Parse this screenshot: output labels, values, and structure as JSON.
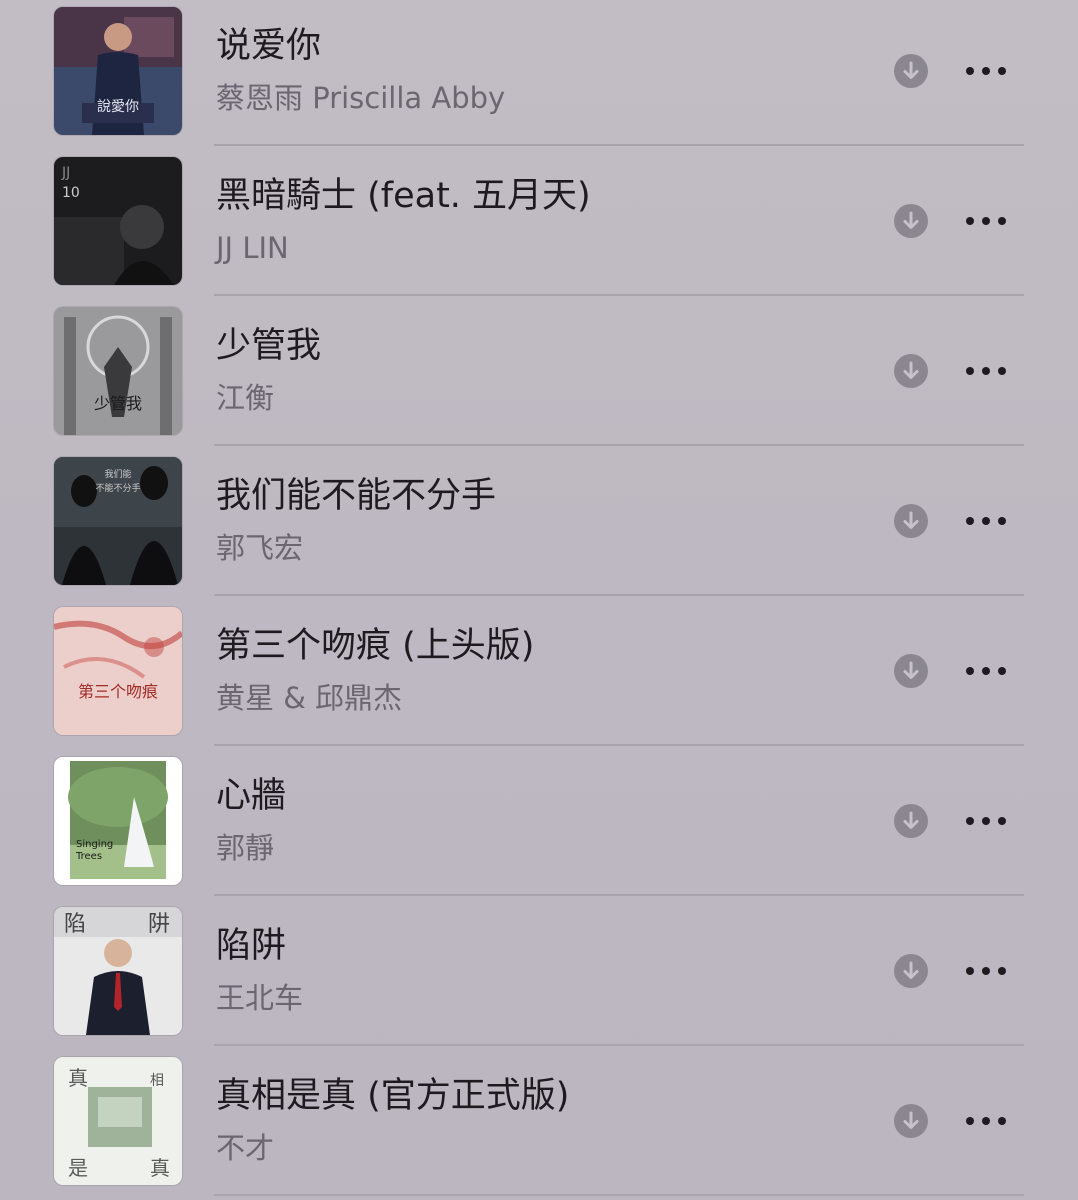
{
  "songs": [
    {
      "title": "说爱你",
      "artist": "蔡恩雨 Priscilla Abby",
      "art_lettering": "說愛你",
      "download_icon": "download-icon",
      "more_icon": "ellipsis-icon"
    },
    {
      "title": "黑暗騎士 (feat. 五月天)",
      "artist": "JJ LIN",
      "art_lettering": "JJ",
      "download_icon": "download-icon",
      "more_icon": "ellipsis-icon"
    },
    {
      "title": "少管我",
      "artist": "江衡",
      "art_lettering": "少管我",
      "download_icon": "download-icon",
      "more_icon": "ellipsis-icon"
    },
    {
      "title": "我们能不能不分手",
      "artist": "郭飞宏",
      "art_lettering": "我们能不能不分手",
      "download_icon": "download-icon",
      "more_icon": "ellipsis-icon"
    },
    {
      "title": "第三个吻痕 (上头版)",
      "artist": "黄星 & 邱鼎杰",
      "art_lettering": "第三个吻痕",
      "download_icon": "download-icon",
      "more_icon": "ellipsis-icon"
    },
    {
      "title": "心牆",
      "artist": "郭靜",
      "art_lettering": "Singing Trees",
      "download_icon": "download-icon",
      "more_icon": "ellipsis-icon"
    },
    {
      "title": "陷阱",
      "artist": "王北车",
      "art_lettering": "陷阱",
      "download_icon": "download-icon",
      "more_icon": "ellipsis-icon"
    },
    {
      "title": "真相是真 (官方正式版)",
      "artist": "不才",
      "art_lettering": "真相是真",
      "download_icon": "download-icon",
      "more_icon": "ellipsis-icon"
    }
  ],
  "colors": {
    "background": "#c0bac4",
    "title": "#1d1b20",
    "subtitle": "#6b6670",
    "icon": "#8b8790",
    "separator": "#a9a3ad"
  }
}
